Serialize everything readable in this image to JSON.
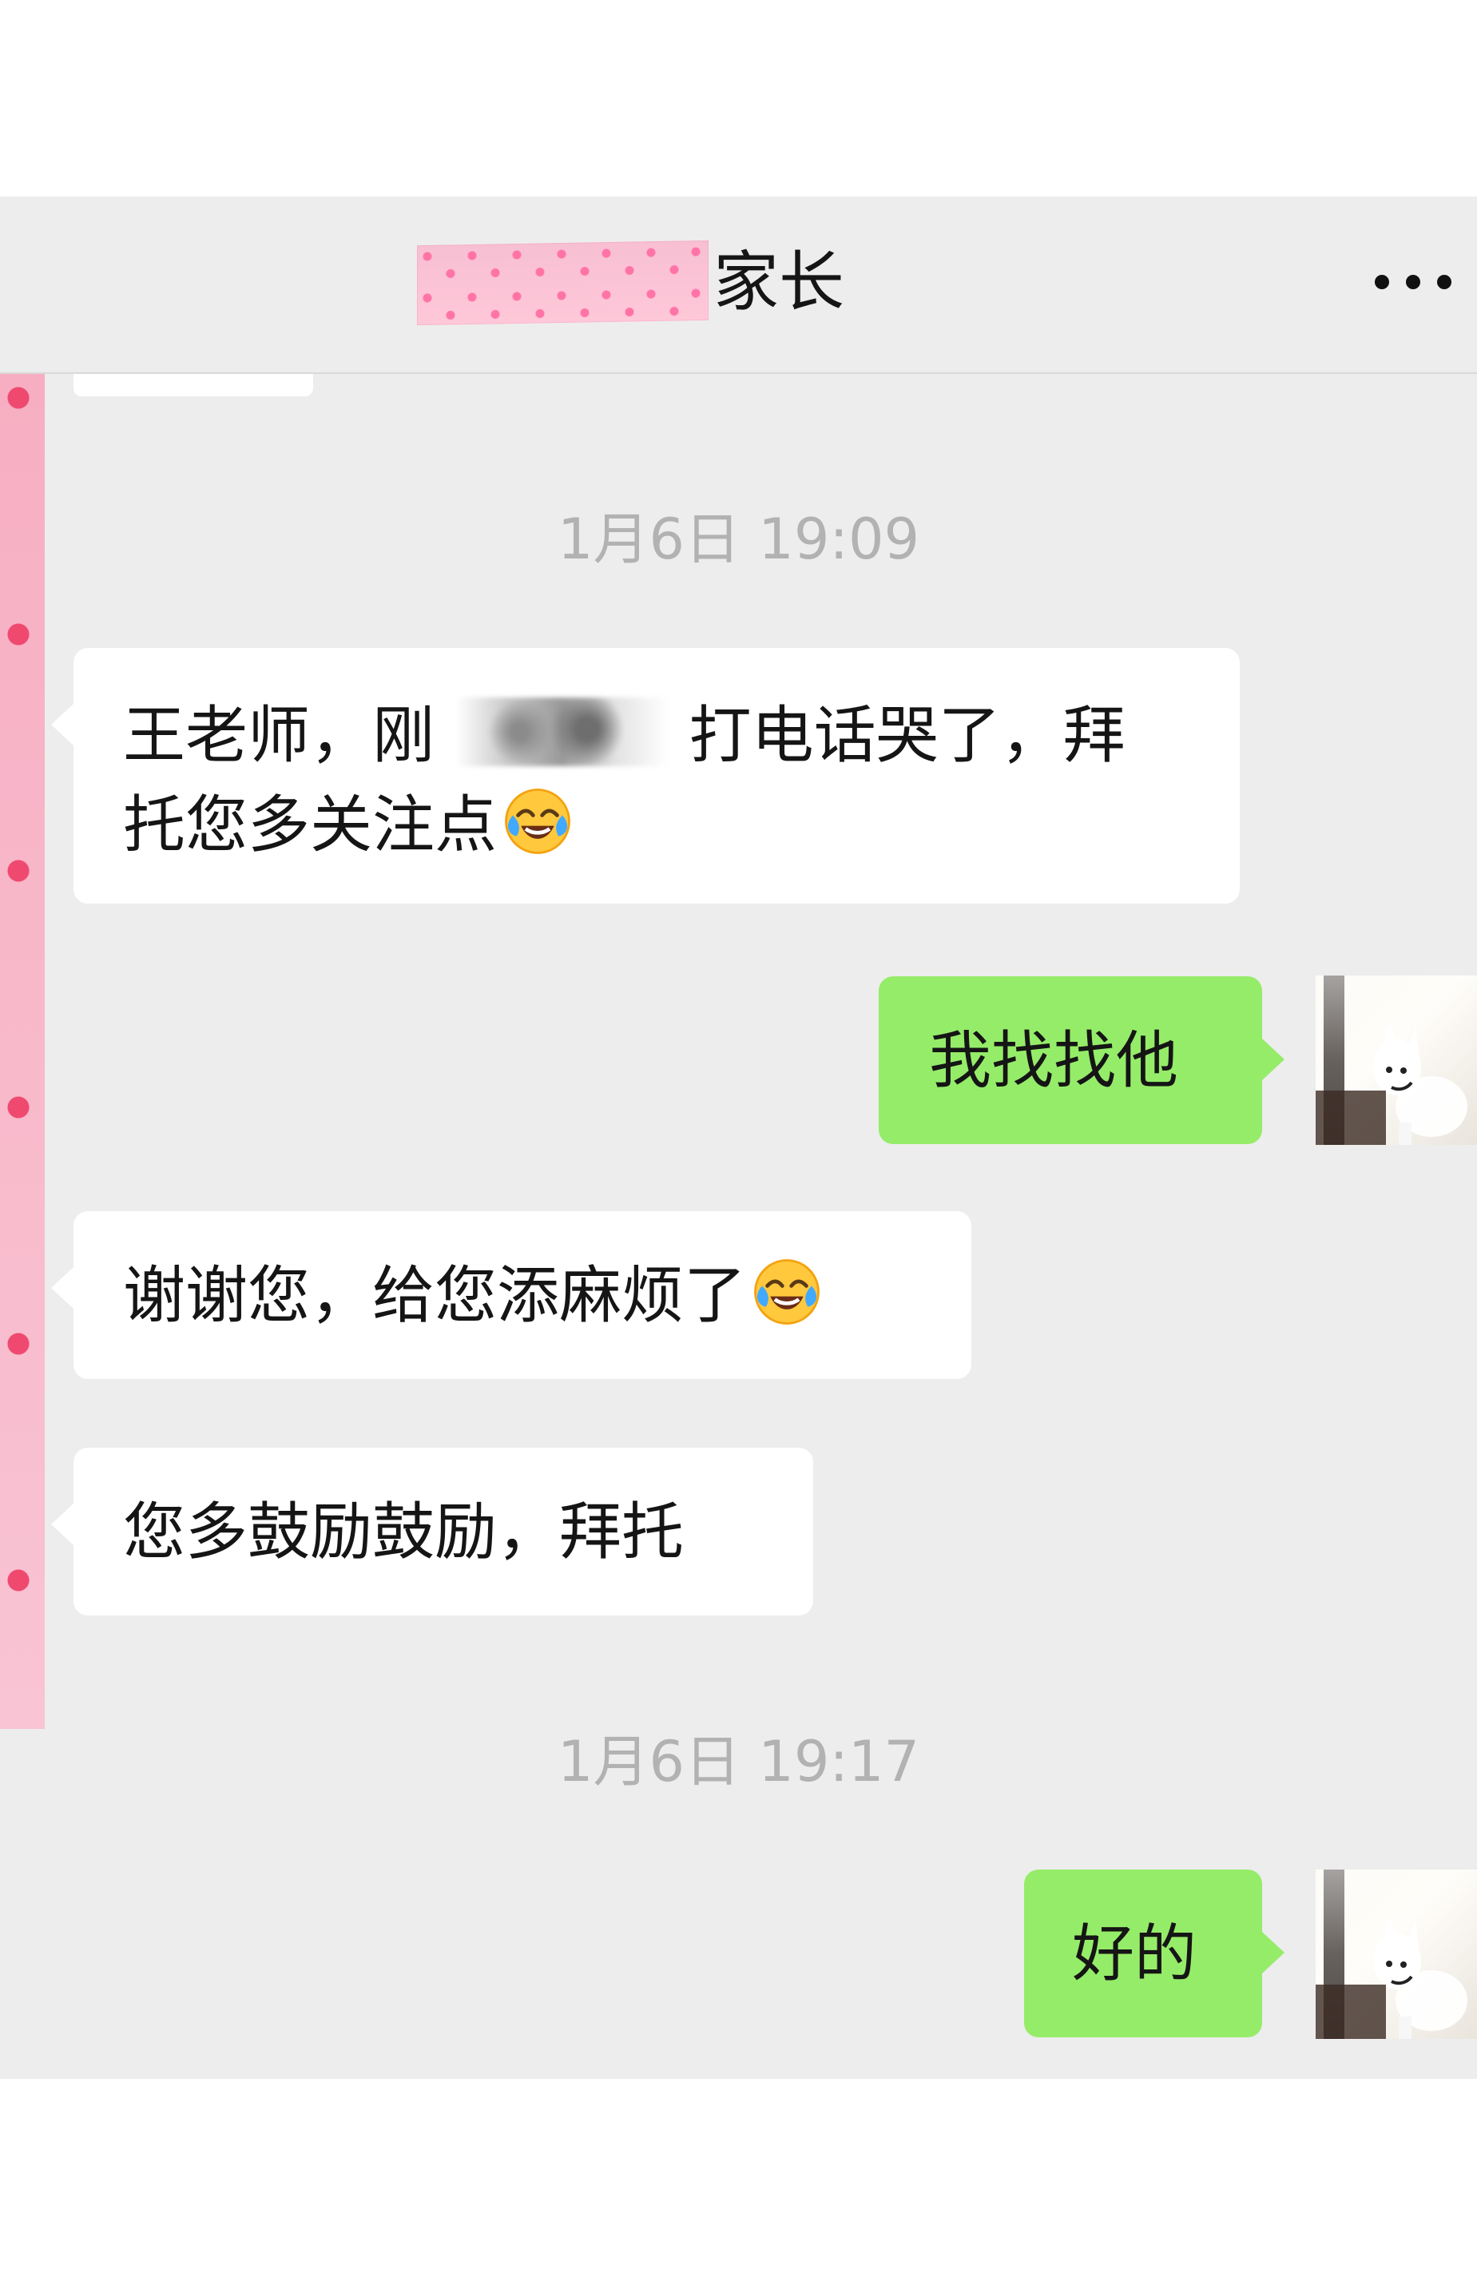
{
  "header": {
    "title": "家长",
    "more_icon": "more-horizontal-icon"
  },
  "messages": {
    "time_1": "1月6日 19:09",
    "msg_1_line_1_start": "王老师，刚",
    "msg_1_line_1_end": "打电话哭了，拜",
    "msg_1_line_2": "托您多关注点",
    "reply_1": "我找找他",
    "msg_2": "谢谢您，给您添麻烦了",
    "msg_3": "您多鼓励鼓励，拜托",
    "time_2": "1月6日 19:17",
    "reply_2": "好的",
    "emoji": "crying-laughing-face-icon"
  },
  "colors": {
    "background": "#ededed",
    "left_bubble": "#ffffff",
    "right_bubble": "#95ec69",
    "time_text": "#b2b2b2",
    "decorative_tape": "#f8a9bf"
  }
}
